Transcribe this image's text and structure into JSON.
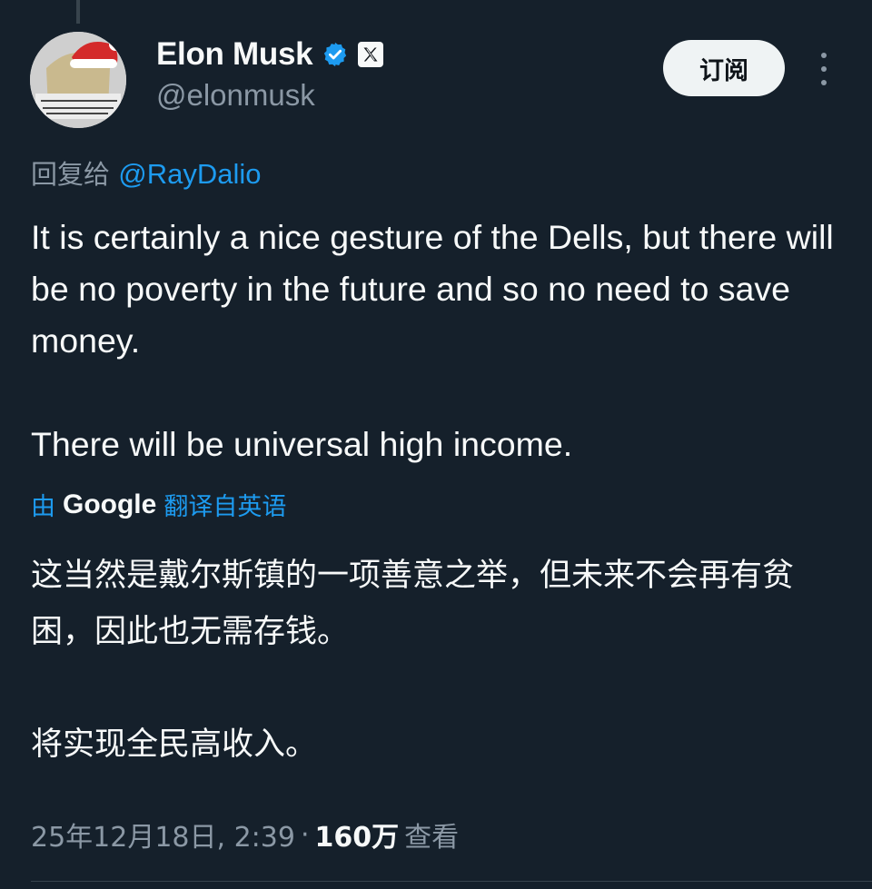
{
  "author": {
    "name": "Elon Musk",
    "handle": "@elonmusk",
    "avatar_icon": "santa-hat-avatar-icon",
    "verified_icon": "verified-badge-icon",
    "affiliate_icon": "x-logo-icon"
  },
  "actions": {
    "subscribe_label": "订阅",
    "more_icon": "more-vertical-icon"
  },
  "reply": {
    "prefix": "回复给",
    "mention": "@RayDalio"
  },
  "tweet": {
    "paragraphs": [
      "It is certainly a nice gesture of the Dells, but there will be no poverty in the future and so no need to save money.",
      "There will be universal high income."
    ]
  },
  "translation": {
    "by": "由",
    "provider": "Google",
    "label": "翻译自英语",
    "paragraphs": [
      "这当然是戴尔斯镇的一项善意之举，但未来不会再有贫困，因此也无需存钱。",
      "将实现全民高收入。"
    ]
  },
  "meta": {
    "timestamp": "25年12月18日, 2:39",
    "separator": "·",
    "views_count": "160万",
    "views_label": "查看"
  },
  "colors": {
    "background": "#15202b",
    "text": "#f7f9f9",
    "muted": "#8b98a5",
    "accent": "#1d9bf0"
  }
}
